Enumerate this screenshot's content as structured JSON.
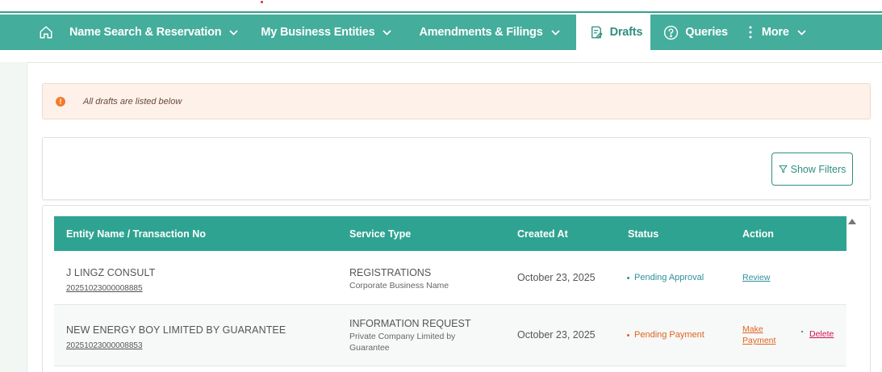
{
  "nav": {
    "items": [
      {
        "label": "Name Search & Reservation",
        "icon": "chevron-down-icon"
      },
      {
        "label": "My Business Entities",
        "icon": "chevron-down-icon"
      },
      {
        "label": "Amendments & Filings",
        "icon": "chevron-down-icon"
      },
      {
        "label": "Drafts",
        "icon": "drafts-icon",
        "active": true
      },
      {
        "label": "Queries",
        "icon": "question-circle-icon"
      },
      {
        "label": "More",
        "icon": "chevron-down-icon"
      }
    ],
    "home_icon": "home-icon",
    "more_icon": "vertical-dots-icon"
  },
  "alert": {
    "icon": "info-icon",
    "message": "All drafts are listed below"
  },
  "filters": {
    "button_label": "Show Filters",
    "icon": "funnel-icon"
  },
  "table": {
    "columns": [
      "Entity Name / Transaction No",
      "Service Type",
      "Created At",
      "Status",
      "Action"
    ],
    "rows": [
      {
        "entity_name": "J LINGZ CONSULT",
        "transaction_no": "20251023000008885",
        "service_type": "REGISTRATIONS",
        "service_sub": "Corporate Business Name",
        "created_at": "October 23, 2025",
        "status": "Pending Approval",
        "actions": [
          "Review"
        ]
      },
      {
        "entity_name": "NEW ENERGY BOY LIMITED BY GUARANTEE",
        "transaction_no": "20251023000008853",
        "service_type": "INFORMATION REQUEST",
        "service_sub": "Private Company Limited by Guarantee",
        "created_at": "October 23, 2025",
        "status": "Pending Payment",
        "actions": [
          "Make Payment",
          "Delete"
        ]
      }
    ]
  },
  "colors": {
    "brand": "#44ad9c",
    "header": "#2fa391",
    "pending_approval": "#2f8f9a",
    "pending_payment": "#e0641f",
    "delete": "#d0164e"
  }
}
